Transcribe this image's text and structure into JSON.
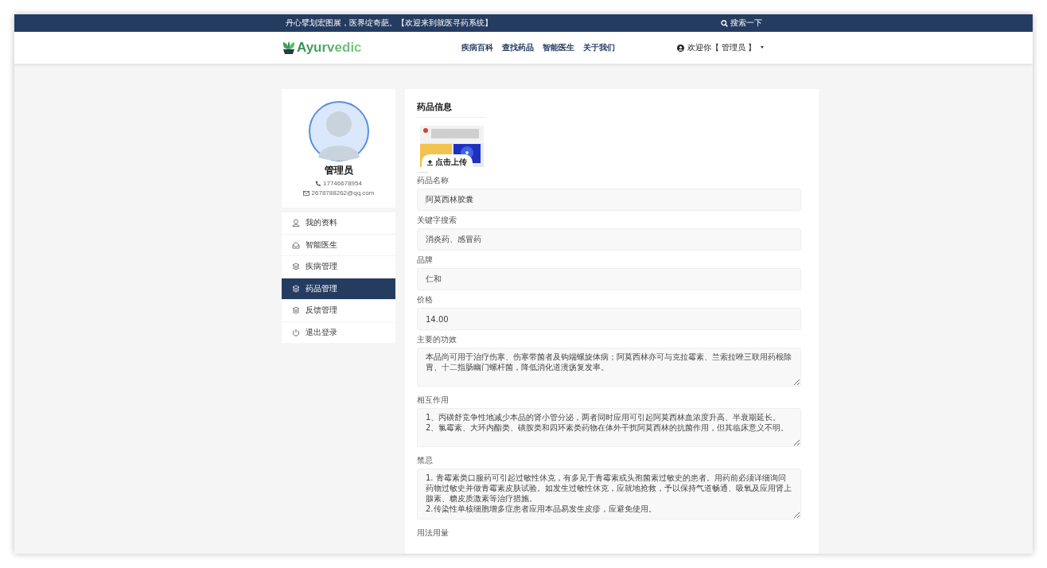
{
  "top_bar": {
    "slogan": "丹心擘划宏图展，医界绽奇葩。【欢迎来到就医寻药系统】",
    "search_link": "搜索一下"
  },
  "navbar": {
    "logo": "Ayurvedic",
    "links": [
      "疾病百科",
      "查找药品",
      "智能医生",
      "关于我们"
    ],
    "user_menu": "欢迎你【 管理员 】"
  },
  "profile": {
    "name": "管理员",
    "phone": "17746678954",
    "email": "2678788262@qq.com"
  },
  "sidebar": {
    "items": [
      {
        "label": "我的资料",
        "selected": false
      },
      {
        "label": "智能医生",
        "selected": false
      },
      {
        "label": "疾病管理",
        "selected": false
      },
      {
        "label": "药品管理",
        "selected": true
      },
      {
        "label": "反馈管理",
        "selected": false
      },
      {
        "label": "退出登录",
        "selected": false
      }
    ]
  },
  "form": {
    "title": "药品信息",
    "image": {
      "kind": "picture",
      "upload_button": "点击上传"
    },
    "fields": [
      {
        "label": "药品名称",
        "kind": "input",
        "value": "阿莫西林胶囊"
      },
      {
        "label": "关键字搜索",
        "kind": "input",
        "value": "消炎药、感冒药"
      },
      {
        "label": "品牌",
        "kind": "input",
        "value": "仁和"
      },
      {
        "label": "价格",
        "kind": "input",
        "value": "14.00"
      },
      {
        "label": "主要的功效",
        "kind": "textarea",
        "value": "本品尚可用于治疗伤寒、伤寒带菌者及钩端螺旋体病；阿莫西林亦可与克拉霉素、兰索拉唑三联用药根除胃、十二指肠幽门螺杆菌，降低消化道溃疡复发率。"
      },
      {
        "label": "相互作用",
        "kind": "textarea",
        "value": "1、丙磺舒竞争性地减少本品的肾小管分泌，两者同时应用可引起阿莫西林血浓度升高、半衰期延长。\n2、氯霉素、大环内酯类、磺胺类和四环素类药物在体外干扰阿莫西林的抗菌作用，但其临床意义不明。"
      },
      {
        "label": "禁忌",
        "kind": "textarea",
        "value": "1. 青霉素类口服药可引起过敏性休克，有多见于青霉素或头孢菌素过敏史的患者。用药前必须详细询问药物过敏史并做青霉素皮肤试验。如发生过敏性休克，应就地抢救，予以保持气道畅通、吸氧及应用肾上腺素、糖皮质激素等治疗措施。\n2.传染性单核细胞增多症患者应用本品易发生皮疹，应避免使用。"
      },
      {
        "label": "用法用量",
        "kind": "label"
      }
    ]
  }
}
